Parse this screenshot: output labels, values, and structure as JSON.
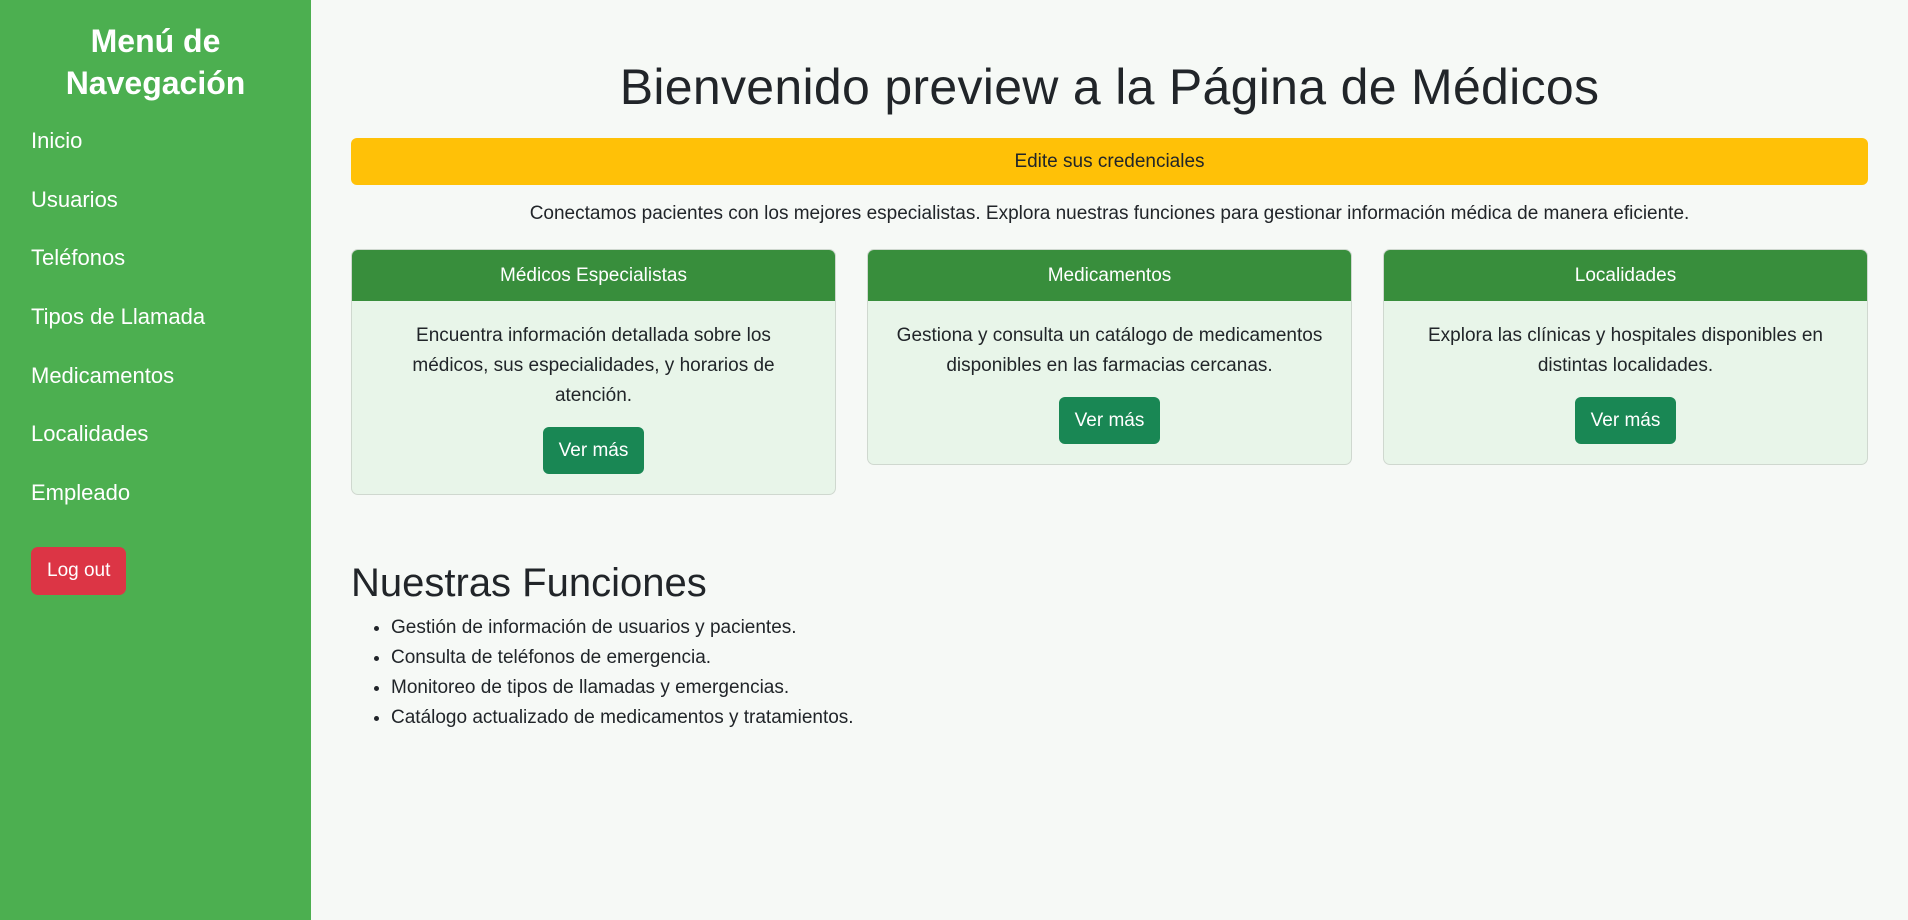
{
  "sidebar": {
    "title": "Menú de Navegación",
    "items": [
      {
        "label": "Inicio"
      },
      {
        "label": "Usuarios"
      },
      {
        "label": "Teléfonos"
      },
      {
        "label": "Tipos de Llamada"
      },
      {
        "label": "Medicamentos"
      },
      {
        "label": "Localidades"
      },
      {
        "label": "Empleado"
      }
    ],
    "logout_label": "Log out"
  },
  "main": {
    "title": "Bienvenido preview a la Página de Médicos",
    "alert": "Edite sus credenciales",
    "intro": "Conectamos pacientes con los mejores especialistas. Explora nuestras funciones para gestionar información médica de manera eficiente.",
    "cards": [
      {
        "header": "Médicos Especialistas",
        "text": "Encuentra información detallada sobre los médicos, sus especialidades, y horarios de atención.",
        "button": "Ver más"
      },
      {
        "header": "Medicamentos",
        "text": "Gestiona y consulta un catálogo de medicamentos disponibles en las farmacias cercanas.",
        "button": "Ver más"
      },
      {
        "header": "Localidades",
        "text": "Explora las clínicas y hospitales disponibles en distintas localidades.",
        "button": "Ver más"
      }
    ],
    "features_title": "Nuestras Funciones",
    "features": [
      "Gestión de información de usuarios y pacientes.",
      "Consulta de teléfonos de emergencia.",
      "Monitoreo de tipos de llamadas y emergencias.",
      "Catálogo actualizado de medicamentos y tratamientos."
    ]
  },
  "colors": {
    "sidebar": "#4caf50",
    "card_header": "#388e3c",
    "card_body": "#e8f5e9",
    "button": "#198754",
    "alert": "#ffc107",
    "logout": "#dc3545"
  }
}
